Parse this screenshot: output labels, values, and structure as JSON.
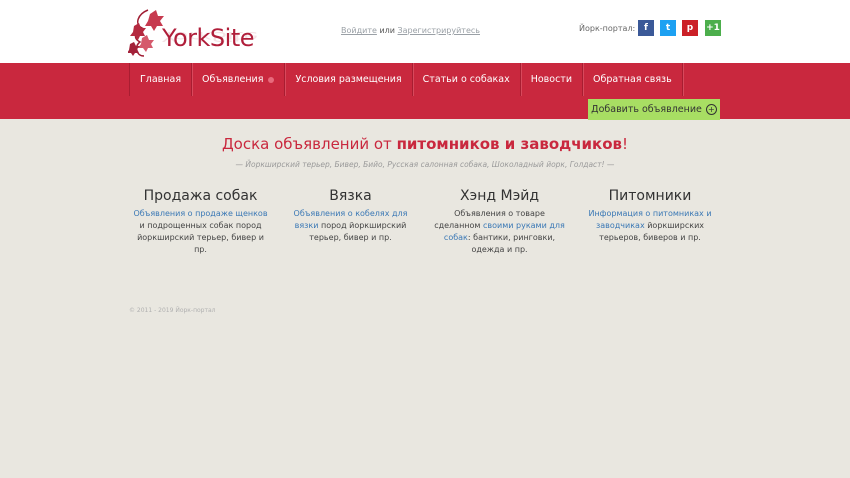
{
  "header": {
    "logo_text": "YorkSite",
    "auth": {
      "login": "Войдите",
      "or": "или",
      "register": "Зарегистрируйтесь"
    },
    "social_label": "Йорк-портал:",
    "social": [
      {
        "icon": "facebook-icon",
        "glyph": "f",
        "color": "#3b5998"
      },
      {
        "icon": "twitter-icon",
        "glyph": "t",
        "color": "#1da1f2"
      },
      {
        "icon": "pinterest-icon",
        "glyph": "p",
        "color": "#cb2027"
      },
      {
        "icon": "google-plus-icon",
        "glyph": "+1",
        "color": "#4cae4c"
      }
    ]
  },
  "nav": {
    "items": [
      {
        "label": "Главная"
      },
      {
        "label": "Объявления"
      },
      {
        "label": "Условия размещения"
      },
      {
        "label": "Статьи о собаках"
      },
      {
        "label": "Новости"
      },
      {
        "label": "Обратная связь"
      }
    ],
    "add_button": "Добавить объявление"
  },
  "main": {
    "headline_pre": "Доска объявлений от ",
    "headline_bold": "питомников и заводчиков",
    "headline_post": "!",
    "subline": "— Йоркширский терьер, Бивер, Бийо, Русская салонная собака, Шоколадный йорк, Голдаст! —",
    "columns": [
      {
        "title": "Продажа собак",
        "link": "Объявления о продаже щенков",
        "text": " и подрощенных собак пород йоркширский терьер, бивер и пр."
      },
      {
        "title": "Вязка",
        "link": "Объявления о кобелях для вязки",
        "text": " пород йоркширский терьер, бивер и пр."
      },
      {
        "title": "Хэнд Мэйд",
        "pre": "Объявления о товаре сделанном ",
        "link": "своими руками для собак",
        "text": ": бантики, ринговки, одежда и пр."
      },
      {
        "title": "Питомники",
        "link": "Информация о питомниках и заводчиках",
        "text": " йоркширских терьеров, биверов и пр."
      }
    ]
  },
  "footer": {
    "text": "© 2011 - 2019 Йорк-портал"
  }
}
